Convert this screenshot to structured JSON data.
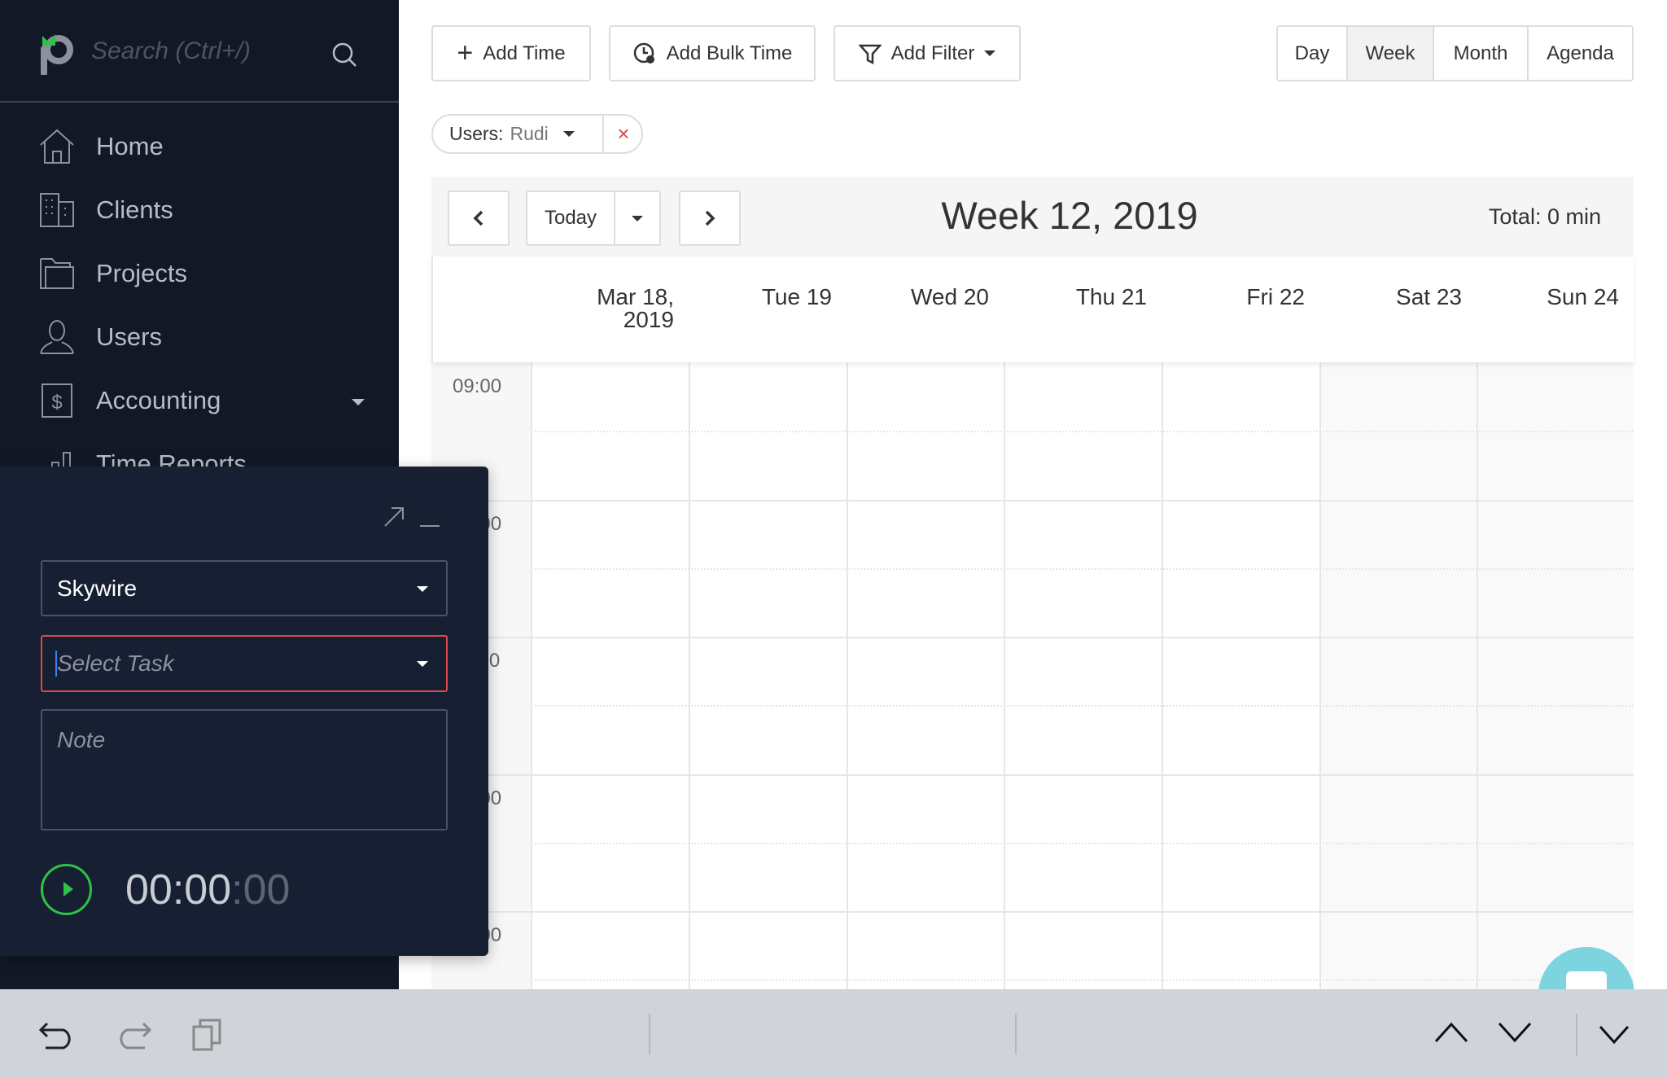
{
  "sidebar": {
    "search_placeholder": "Search (Ctrl+/)",
    "items": [
      {
        "label": "Home",
        "icon": "home-icon"
      },
      {
        "label": "Clients",
        "icon": "building-icon"
      },
      {
        "label": "Projects",
        "icon": "folder-icon"
      },
      {
        "label": "Users",
        "icon": "user-icon"
      },
      {
        "label": "Accounting",
        "icon": "ledger-icon"
      },
      {
        "label": "Time Reports",
        "icon": "bar-chart-icon"
      }
    ]
  },
  "toolbar": {
    "add_time": "Add Time",
    "add_bulk_time": "Add Bulk Time",
    "add_filter": "Add Filter"
  },
  "views": {
    "day": "Day",
    "week": "Week",
    "month": "Month",
    "agenda": "Agenda",
    "active": "Week"
  },
  "filter": {
    "label": "Users:",
    "value": "Rudi"
  },
  "calendar": {
    "today": "Today",
    "title": "Week 12, 2019",
    "total_label": "Total:",
    "total_value": "0 min",
    "days": [
      "Mar 18,\n2019",
      "Tue 19",
      "Wed 20",
      "Thu 21",
      "Fri 22",
      "Sat 23",
      "Sun 24"
    ],
    "times": [
      "09:00",
      "10:00",
      "11:00",
      "12:00",
      "13:00"
    ]
  },
  "timer": {
    "project": "Skywire",
    "task_placeholder": "Select Task",
    "note_placeholder": "Note",
    "time_main": "00:00",
    "time_seconds": ":00"
  },
  "colors": {
    "sidebar": "#121826",
    "panel": "#172033",
    "accent_green": "#2fc24a",
    "error": "#e04848",
    "fab": "#7dd3de"
  }
}
